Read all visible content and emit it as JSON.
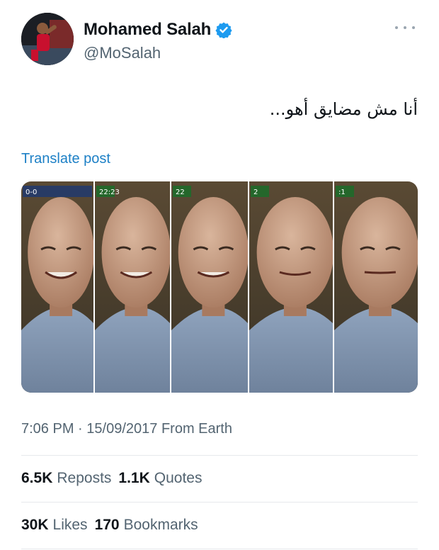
{
  "author": {
    "display_name": "Mohamed Salah",
    "handle": "@MoSalah",
    "verified": true
  },
  "post": {
    "text": "أنا مش مضايق أهو...",
    "translate_label": "Translate post",
    "media_description": "five-frame photo strip of a smiling man",
    "media_frame_labels": [
      "0-0",
      "22:23",
      "22",
      "2",
      ":1"
    ]
  },
  "meta": {
    "time": "7:06 PM",
    "separator": "·",
    "date": "15/09/2017",
    "source": "From Earth"
  },
  "stats": {
    "reposts_count": "6.5K",
    "reposts_label": "Reposts",
    "quotes_count": "1.1K",
    "quotes_label": "Quotes",
    "likes_count": "30K",
    "likes_label": "Likes",
    "bookmarks_count": "170",
    "bookmarks_label": "Bookmarks"
  },
  "colors": {
    "link": "#1d80c6",
    "verified": "#1d9bf0",
    "secondary_text": "#536471"
  },
  "icons": [
    "verified-badge-icon",
    "more-options-icon"
  ]
}
